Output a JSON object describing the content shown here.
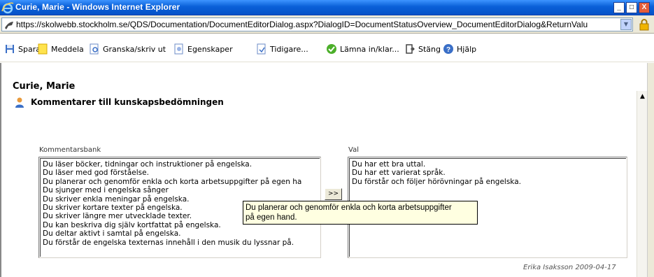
{
  "window": {
    "title": "Curie, Marie - Windows Internet Explorer",
    "controls": {
      "minimize": "_",
      "maximize": "□",
      "close": "X"
    }
  },
  "address": {
    "url": "https://skolwebb.stockholm.se/QDS/Documentation/DocumentEditorDialog.aspx?DialogID=DocumentStatusOverview_DocumentEditorDialog&ReturnValu"
  },
  "toolbar": {
    "items": [
      {
        "label": "Spara",
        "icon": "floppy-icon"
      },
      {
        "label": "Meddela",
        "icon": "note-icon"
      },
      {
        "label": "Granska/skriv ut",
        "icon": "preview-icon"
      },
      {
        "label": "Egenskaper",
        "icon": "properties-icon"
      },
      {
        "label": "Tidigare...",
        "icon": "history-icon"
      },
      {
        "label": "Lämna in/klar...",
        "icon": "checkmark-icon"
      },
      {
        "label": "Stäng",
        "icon": "close-door-icon"
      },
      {
        "label": "Hjälp",
        "icon": "help-icon"
      }
    ]
  },
  "page": {
    "person_name": "Curie, Marie",
    "section_title": "Kommentarer till kunskapsbedömningen"
  },
  "comment_bank": {
    "label": "Kommentarsbank",
    "items": [
      "Du läser böcker, tidningar och instruktioner på engelska.",
      "Du läser med god förståelse.",
      "Du planerar och genomför enkla och korta arbetsuppgifter på egen ha",
      "Du sjunger med i engelska sånger",
      "Du skriver enkla meningar på engelska.",
      "Du skriver kortare texter på engelska.",
      "Du skriver längre mer utvecklade texter.",
      "Du kan beskriva dig själv kortfattat på engelska.",
      "Du deltar aktivt i samtal på engelska.",
      "Du förstår de engelska texternas innehåll i den musik du lyssnar på."
    ]
  },
  "selected": {
    "label": "Val",
    "items": [
      "Du har ett bra uttal.",
      "Du har ett varierat språk.",
      "Du förstår och följer hörövningar på engelska."
    ]
  },
  "move_button": {
    "label": ">>"
  },
  "tooltip": {
    "line1": "Du planerar och genomför enkla och korta arbetsuppgifter",
    "line2": "på egen hand."
  },
  "signature": "Erika Isaksson 2009-04-17"
}
